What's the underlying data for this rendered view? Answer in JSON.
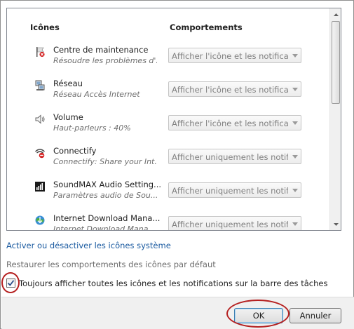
{
  "header": {
    "icons_col": "Icônes",
    "behaviors_col": "Comportements"
  },
  "rows": [
    {
      "icon": "action-center-flag-icon",
      "name": "Centre de maintenance",
      "desc": "Résoudre les problèmes d'...",
      "behavior": "Afficher l'icône et les notificatio"
    },
    {
      "icon": "network-icon",
      "name": "Réseau",
      "desc": "Réseau Accès Internet",
      "behavior": "Afficher l'icône et les notificatio"
    },
    {
      "icon": "speaker-volume-icon",
      "name": "Volume",
      "desc": "Haut-parleurs : 40%",
      "behavior": "Afficher l'icône et les notificatio"
    },
    {
      "icon": "connectify-wifi-icon",
      "name": "Connectify",
      "desc": "Connectify: Share your Int...",
      "behavior": "Afficher uniquement les notificati"
    },
    {
      "icon": "soundmax-icon",
      "name": "SoundMAX Audio Setting...",
      "desc": "Paramètres audio de Sou...",
      "behavior": "Afficher uniquement les notificati"
    },
    {
      "icon": "internet-download-manager-icon",
      "name": "Internet Download Mana...",
      "desc": "Internet Download Mana...",
      "behavior": "Afficher uniquement les notificati"
    }
  ],
  "links": {
    "system_icons": "Activer ou désactiver les icônes système",
    "restore_defaults": "Restaurer les comportements des icônes par défaut"
  },
  "checkbox": {
    "label": "Toujours afficher toutes les icônes et les notifications sur la barre des tâches",
    "checked": true
  },
  "buttons": {
    "ok": "OK",
    "cancel": "Annuler"
  },
  "colors": {
    "link": "#1a5aa0",
    "annotation_circle": "#b52020",
    "disabled_text": "#808080"
  }
}
